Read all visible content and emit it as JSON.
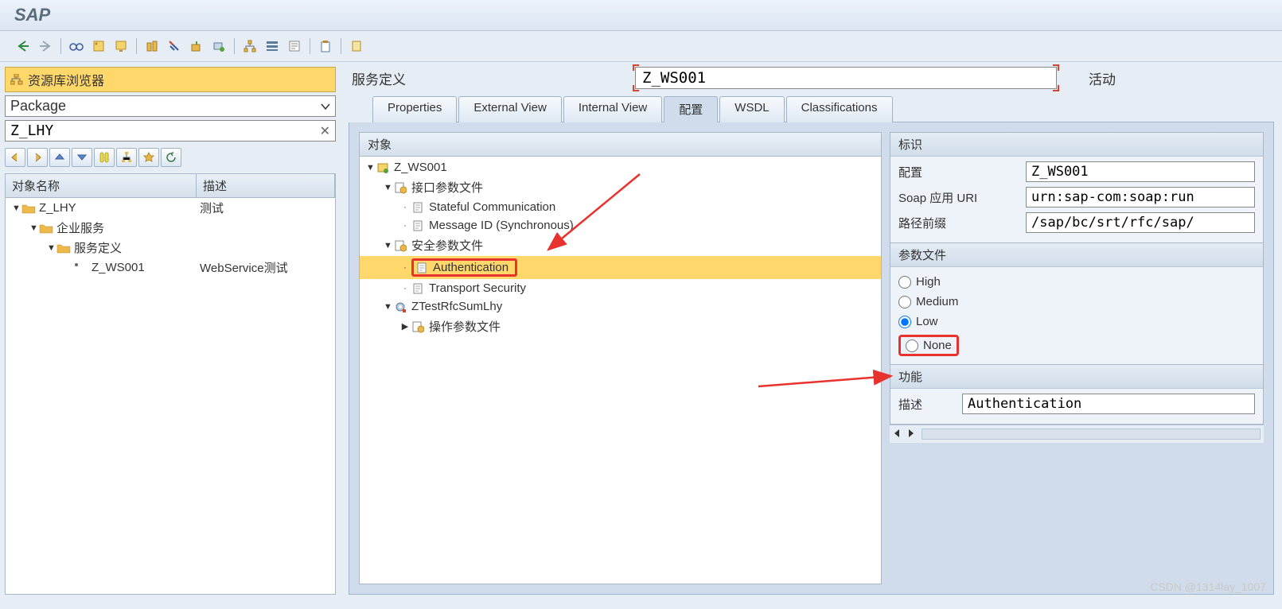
{
  "app_title": "SAP",
  "repo_browser_title": "资源库浏览器",
  "package_select": "Package",
  "package_input": "Z_LHY",
  "tree_header": {
    "col1": "对象名称",
    "col2": "描述"
  },
  "left_tree": [
    {
      "indent": 0,
      "exp": "▼",
      "icon": "folder",
      "label": "Z_LHY",
      "desc": "测试"
    },
    {
      "indent": 1,
      "exp": "▼",
      "icon": "folder",
      "label": "企业服务",
      "desc": ""
    },
    {
      "indent": 2,
      "exp": "▼",
      "icon": "folder",
      "label": "服务定义",
      "desc": ""
    },
    {
      "indent": 3,
      "exp": "",
      "icon": "dot",
      "label": "Z_WS001",
      "desc": "WebService测试"
    }
  ],
  "service_definition_label": "服务定义",
  "service_definition_value": "Z_WS001",
  "service_status": "活动",
  "tabs": [
    "Properties",
    "External View",
    "Internal View",
    "配置",
    "WSDL",
    "Classifications"
  ],
  "active_tab_index": 3,
  "object_tree_header": "对象",
  "object_tree": [
    {
      "indent": 0,
      "exp": "▼",
      "icon": "svc",
      "label": "Z_WS001"
    },
    {
      "indent": 1,
      "exp": "▼",
      "icon": "profile",
      "label": "接口参数文件"
    },
    {
      "indent": 2,
      "exp": "·",
      "icon": "doc",
      "label": "Stateful Communication"
    },
    {
      "indent": 2,
      "exp": "·",
      "icon": "doc",
      "label": "Message ID (Synchronous)"
    },
    {
      "indent": 1,
      "exp": "▼",
      "icon": "profile",
      "label": "安全参数文件"
    },
    {
      "indent": 2,
      "exp": "·",
      "icon": "doc",
      "label": "Authentication",
      "selected": true,
      "highlight": true
    },
    {
      "indent": 2,
      "exp": "·",
      "icon": "doc",
      "label": "Transport Security"
    },
    {
      "indent": 1,
      "exp": "▼",
      "icon": "gear",
      "label": "ZTestRfcSumLhy"
    },
    {
      "indent": 2,
      "exp": "▶",
      "icon": "profile",
      "label": "操作参数文件"
    }
  ],
  "identification": {
    "section_title": "标识",
    "fields": [
      {
        "label": "配置",
        "value": "Z_WS001"
      },
      {
        "label": "Soap 应用 URI",
        "value": "urn:sap-com:soap:run"
      },
      {
        "label": "路径前缀",
        "value": "/sap/bc/srt/rfc/sap/"
      }
    ]
  },
  "profile": {
    "section_title": "参数文件",
    "options": [
      {
        "label": "High",
        "checked": false
      },
      {
        "label": "Medium",
        "checked": false
      },
      {
        "label": "Low",
        "checked": true
      },
      {
        "label": "None",
        "checked": false,
        "highlight": true
      }
    ]
  },
  "function": {
    "section_title": "功能",
    "desc_label": "描述",
    "desc_value": "Authentication"
  },
  "watermark": "CSDN @1314lay_1007"
}
